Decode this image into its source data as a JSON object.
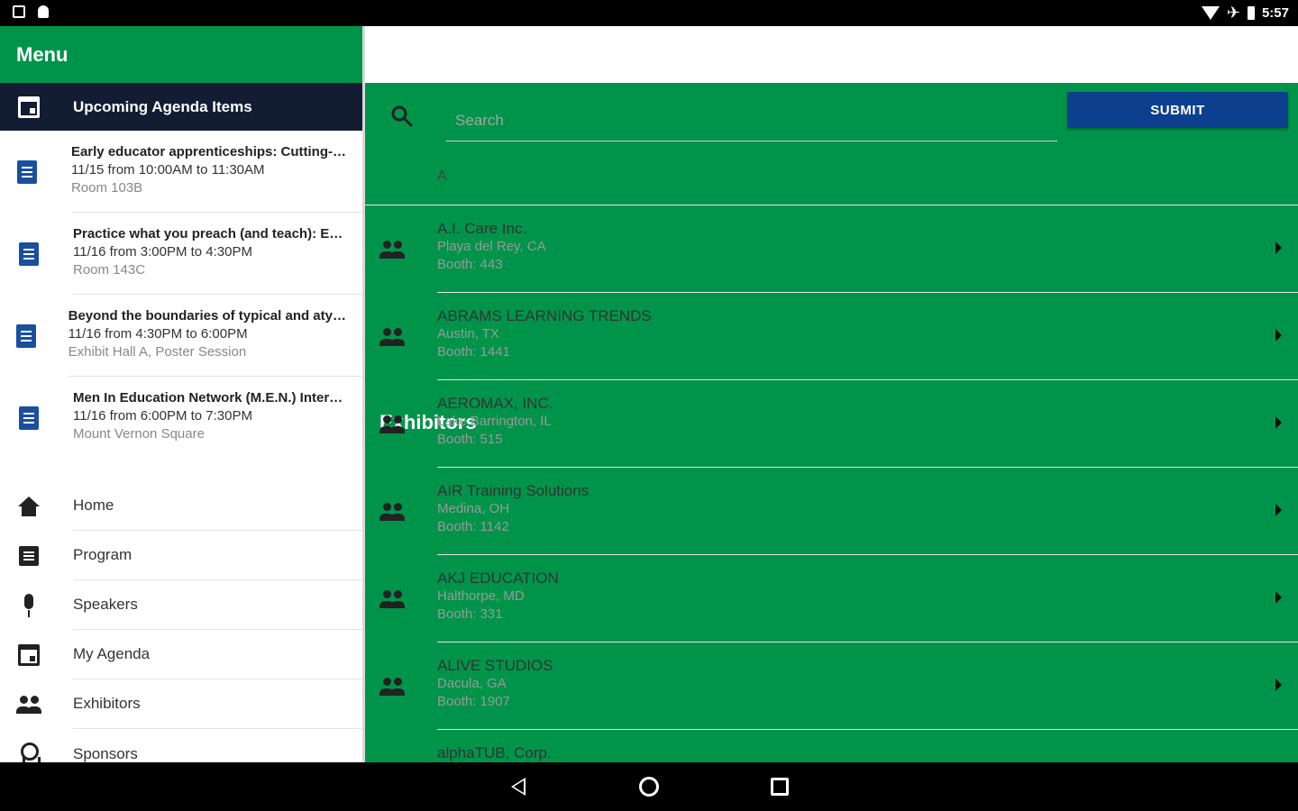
{
  "status_bar": {
    "time": "5:57"
  },
  "menu": {
    "title": "Menu",
    "header_label": "Upcoming Agenda Items",
    "agenda": [
      {
        "title": "Early educator apprenticeships: Cutting-…",
        "time": "11/15 from 10:00AM to 11:30AM",
        "location": "Room 103B",
        "icon": "document-icon"
      },
      {
        "title": "Practice what you preach (and teach): E…",
        "time": "11/16 from 3:00PM to 4:30PM",
        "location": "Room 143C",
        "icon": "document-icon"
      },
      {
        "title": "Beyond the boundaries of typical and aty…",
        "time": "11/16 from 4:30PM to 6:00PM",
        "location": "Exhibit Hall A, Poster Session",
        "icon": "document-icon"
      },
      {
        "title": "Men In Education Network (M.E.N.) Inter…",
        "time": "11/16 from 6:00PM to 7:30PM",
        "location": "Mount Vernon Square",
        "icon": "document-icon"
      }
    ],
    "nav": [
      {
        "label": "Home",
        "icon": "home-icon"
      },
      {
        "label": "Program",
        "icon": "program-icon"
      },
      {
        "label": "Speakers",
        "icon": "microphone-icon"
      },
      {
        "label": "My Agenda",
        "icon": "calendar-icon"
      },
      {
        "label": "Exhibitors",
        "icon": "people-icon"
      },
      {
        "label": "Sponsors",
        "icon": "award-icon"
      }
    ]
  },
  "main": {
    "title": "Exhibitors",
    "search": {
      "placeholder": "Search",
      "value": ""
    },
    "submit_label": "SUBMIT",
    "section_letter": "A",
    "exhibitors": [
      {
        "name": "A.I. Care Inc.",
        "location": "Playa del Rey, CA",
        "booth": "Booth: 443"
      },
      {
        "name": "ABRAMS LEARNING TRENDS",
        "location": "Austin, TX",
        "booth": "Booth: 1441"
      },
      {
        "name": "AEROMAX, INC.",
        "location": "Lake Barrington, IL",
        "booth": "Booth: 515"
      },
      {
        "name": "AIR Training Solutions",
        "location": "Medina, OH",
        "booth": "Booth: 1142"
      },
      {
        "name": "AKJ EDUCATION",
        "location": "Halthorpe, MD",
        "booth": "Booth: 331"
      },
      {
        "name": "ALIVE STUDIOS",
        "location": "Dacula, GA",
        "booth": "Booth: 1907"
      },
      {
        "name": "alphaTUB, Corp.",
        "location": "",
        "booth": ""
      }
    ]
  },
  "colors": {
    "appbar": "#00944a",
    "header_dark": "#121d33",
    "submit": "#0d3f8f",
    "doc_icon": "#1a4fa0"
  }
}
